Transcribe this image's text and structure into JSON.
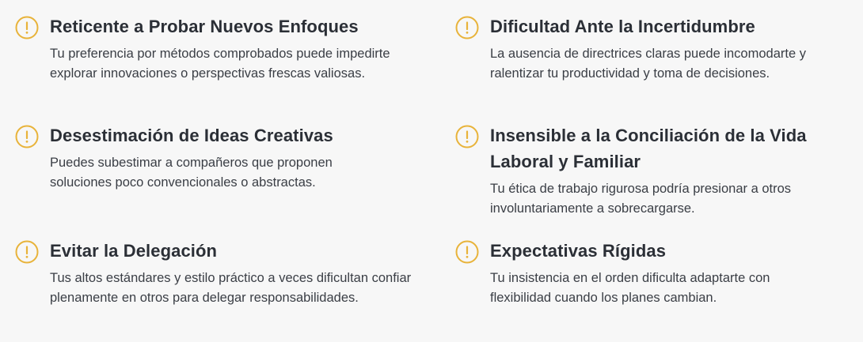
{
  "accent_color": "#e8b33a",
  "items": [
    {
      "icon": "warning-circle-icon",
      "title": "Reticente a Probar Nuevos Enfoques",
      "description": "Tu preferencia por métodos comprobados puede impedirte explorar innovaciones o perspectivas frescas valiosas."
    },
    {
      "icon": "warning-circle-icon",
      "title": "Dificultad Ante la Incertidumbre",
      "description": "La ausencia de directrices claras puede incomodarte y ralentizar tu productividad y toma de decisiones."
    },
    {
      "icon": "warning-circle-icon",
      "title": "Desestimación de Ideas Creativas",
      "description": "Puedes subestimar a compañeros que proponen soluciones poco convencionales o abstractas."
    },
    {
      "icon": "warning-circle-icon",
      "title": "Insensible a la Conciliación de la Vida Laboral y Familiar",
      "description": "Tu ética de trabajo rigurosa podría presionar a otros involuntariamente a sobrecargarse."
    },
    {
      "icon": "warning-circle-icon",
      "title": "Evitar la Delegación",
      "description": "Tus altos estándares y estilo práctico a veces dificultan confiar plenamente en otros para delegar responsabilidades."
    },
    {
      "icon": "warning-circle-icon",
      "title": "Expectativas Rígidas",
      "description": "Tu insistencia en el orden dificulta adaptarte con flexibilidad cuando los planes cambian."
    }
  ]
}
